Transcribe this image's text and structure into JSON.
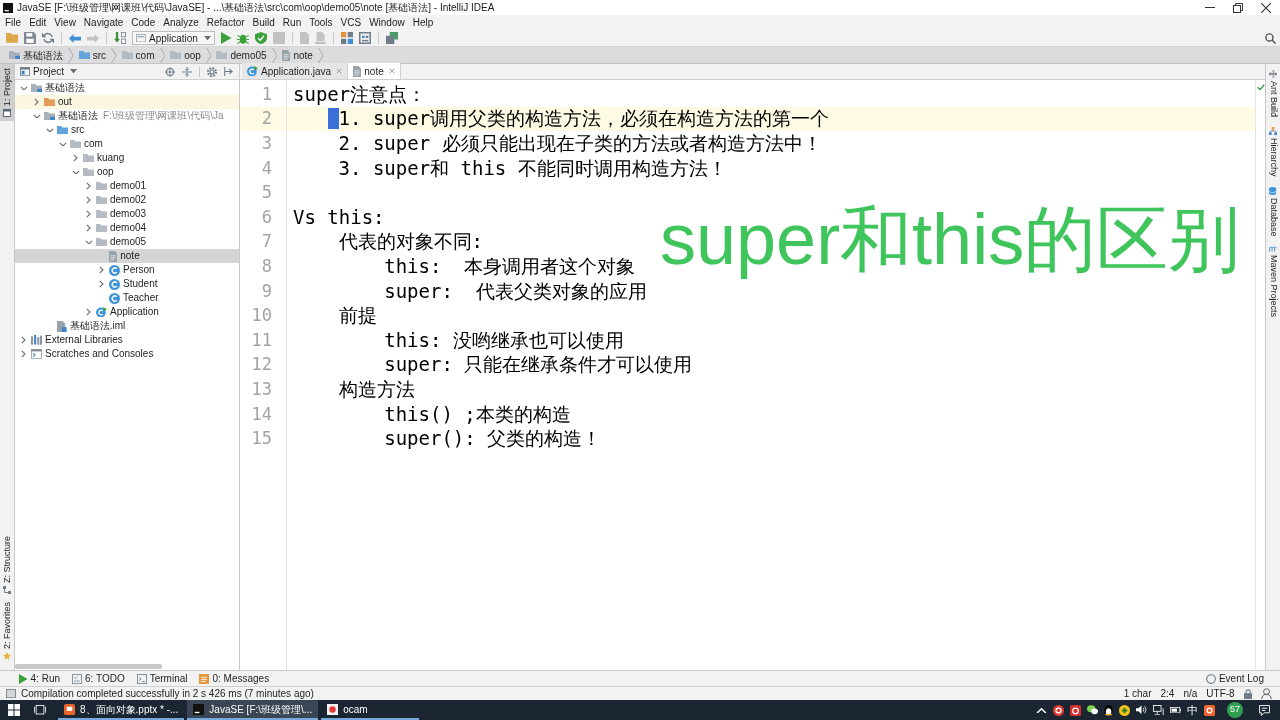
{
  "window": {
    "title": "JavaSE [F:\\班级管理\\网课班\\代码\\JavaSE] - ...\\基础语法\\src\\com\\oop\\demo05\\note [基础语法] - IntelliJ IDEA"
  },
  "menu": [
    "File",
    "Edit",
    "View",
    "Navigate",
    "Code",
    "Analyze",
    "Refactor",
    "Build",
    "Run",
    "Tools",
    "VCS",
    "Window",
    "Help"
  ],
  "toolbar": {
    "groups": [
      [
        {
          "kind": "open",
          "disabled": false
        },
        {
          "kind": "save",
          "disabled": false
        },
        {
          "kind": "sync",
          "disabled": false
        }
      ],
      [
        {
          "kind": "back",
          "disabled": false
        },
        {
          "kind": "forward",
          "disabled": true
        }
      ],
      [
        {
          "kind": "build",
          "disabled": false
        },
        {
          "kind": "run-config",
          "label": "Application"
        },
        {
          "kind": "run",
          "disabled": false
        },
        {
          "kind": "debug",
          "disabled": false
        },
        {
          "kind": "coverage",
          "disabled": false
        },
        {
          "kind": "stop",
          "disabled": true
        }
      ],
      [
        {
          "kind": "document",
          "disabled": true
        },
        {
          "kind": "document-arrow",
          "disabled": true
        }
      ],
      [
        {
          "kind": "structure",
          "disabled": false
        },
        {
          "kind": "sdk",
          "disabled": false
        }
      ],
      [
        {
          "kind": "window",
          "disabled": false
        }
      ]
    ]
  },
  "breadcrumbs": [
    {
      "label": "基础语法",
      "kind": "module"
    },
    {
      "label": "src",
      "kind": "source-folder"
    },
    {
      "label": "com",
      "kind": "package"
    },
    {
      "label": "oop",
      "kind": "package"
    },
    {
      "label": "demo05",
      "kind": "package"
    },
    {
      "label": "note",
      "kind": "text-file"
    }
  ],
  "left_stripe": {
    "top": [
      {
        "label": "1: Project",
        "kind": "project",
        "selected": true
      }
    ],
    "bottom": [
      {
        "label": "Z: Structure",
        "kind": "structure-tool",
        "selected": false
      },
      {
        "label": "2: Favorites",
        "kind": "favorites",
        "selected": false
      }
    ]
  },
  "project_panel": {
    "title": "Project",
    "tree": [
      {
        "label": "基础语法",
        "kind": "module",
        "expanded": true,
        "selected": false,
        "children": [
          {
            "label": "out",
            "kind": "excluded-folder",
            "expanded": false,
            "selected": false
          },
          {
            "label": "基础语法",
            "path": "F:\\班级管理\\网课班\\代码\\Ja",
            "kind": "module",
            "expanded": true,
            "selected": false,
            "children": [
              {
                "label": "src",
                "kind": "source-folder",
                "expanded": true,
                "selected": false,
                "children": [
                  {
                    "label": "com",
                    "kind": "package",
                    "expanded": true,
                    "selected": false,
                    "children": [
                      {
                        "label": "kuang",
                        "kind": "package",
                        "expanded": false,
                        "selected": false
                      },
                      {
                        "label": "oop",
                        "kind": "package",
                        "expanded": true,
                        "selected": false,
                        "children": [
                          {
                            "label": "demo01",
                            "kind": "package",
                            "expanded": false,
                            "selected": false
                          },
                          {
                            "label": "demo02",
                            "kind": "package",
                            "expanded": false,
                            "selected": false
                          },
                          {
                            "label": "demo03",
                            "kind": "package",
                            "expanded": false,
                            "selected": false
                          },
                          {
                            "label": "demo04",
                            "kind": "package",
                            "expanded": false,
                            "selected": false
                          },
                          {
                            "label": "demo05",
                            "kind": "package",
                            "expanded": true,
                            "selected": false,
                            "children": [
                              {
                                "label": "note",
                                "kind": "text-file",
                                "selected": true
                              },
                              {
                                "label": "Person",
                                "kind": "class",
                                "expanded": false,
                                "selected": false
                              },
                              {
                                "label": "Student",
                                "kind": "class",
                                "expanded": false,
                                "selected": false
                              },
                              {
                                "label": "Teacher",
                                "kind": "class",
                                "selected": false
                              }
                            ]
                          },
                          {
                            "label": "Application",
                            "kind": "main-class",
                            "expanded": false,
                            "selected": false
                          }
                        ]
                      }
                    ]
                  }
                ]
              },
              {
                "label": "基础语法.iml",
                "kind": "module-file",
                "selected": false
              }
            ]
          }
        ]
      },
      {
        "label": "External Libraries",
        "kind": "libraries",
        "expanded": false,
        "selected": false
      },
      {
        "label": "Scratches and Consoles",
        "kind": "scratches",
        "expanded": false,
        "selected": false
      }
    ]
  },
  "editor_tabs": [
    {
      "label": "Application.java",
      "kind": "main-class",
      "selected": false
    },
    {
      "label": "note",
      "kind": "text-file",
      "selected": true
    }
  ],
  "editor": {
    "line_numbers": [
      "1",
      "2",
      "3",
      "4",
      "5",
      "6",
      "7",
      "8",
      "9",
      "10",
      "11",
      "12",
      "13",
      "14",
      "15"
    ],
    "blocks": [
      {
        "text": "super注意点：",
        "current": false,
        "children": [
          {
            "text": "1. super调用父类的构造方法，必须在构造方法的第一个",
            "current": true
          },
          {
            "text": "2. super 必须只能出现在子类的方法或者构造方法中！",
            "current": false
          },
          {
            "text": "3. super和 this 不能同时调用构造方法！",
            "current": false
          }
        ]
      },
      {
        "text": "Vs this:",
        "current": false,
        "children": [
          {
            "text": "代表的对象不同:",
            "current": false,
            "children": [
              {
                "text": "this:  本身调用者这个对象",
                "current": false
              },
              {
                "text": "super:  代表父类对象的应用",
                "current": false
              }
            ]
          },
          {
            "text": "前提",
            "current": false,
            "children": [
              {
                "text": "this: 没哟继承也可以使用",
                "current": false
              },
              {
                "text": "super: 只能在继承条件才可以使用",
                "current": false
              }
            ]
          },
          {
            "text": "构造方法",
            "current": false,
            "children": [
              {
                "text": "this() ;本类的构造",
                "current": false
              },
              {
                "text": "super(): 父类的构造！",
                "current": false
              }
            ]
          }
        ]
      }
    ]
  },
  "overlay_caption": {
    "text": "super和this的区别"
  },
  "right_stripe": [
    {
      "label": "Ant Build",
      "kind": "ant"
    },
    {
      "label": "Hierarchy",
      "kind": "hierarchy"
    },
    {
      "label": "Database",
      "kind": "database"
    },
    {
      "label": "Maven Projects",
      "kind": "maven"
    }
  ],
  "tool_window_bar": {
    "items": [
      {
        "label": "4: Run",
        "kind": "run"
      },
      {
        "label": "6: TODO",
        "kind": "todo"
      },
      {
        "label": "Terminal",
        "kind": "terminal"
      },
      {
        "label": "0: Messages",
        "kind": "messages"
      }
    ],
    "event_log": "Event Log"
  },
  "status_bar": {
    "message": "Compilation completed successfully in 2 s 426 ms (7 minutes ago)",
    "items": [
      "1 char",
      "2:4",
      "n/a",
      "UTF-8"
    ]
  },
  "taskbar": {
    "apps": [
      {
        "label": "8、面向对象.pptx * -...",
        "kind": "presentation",
        "selected": false
      },
      {
        "label": "JavaSE [F:\\班级管理\\...",
        "kind": "ij",
        "selected": true
      },
      {
        "label": "ocam",
        "kind": "recorder",
        "selected": false
      }
    ],
    "input_method": "中",
    "badge": "57"
  }
}
